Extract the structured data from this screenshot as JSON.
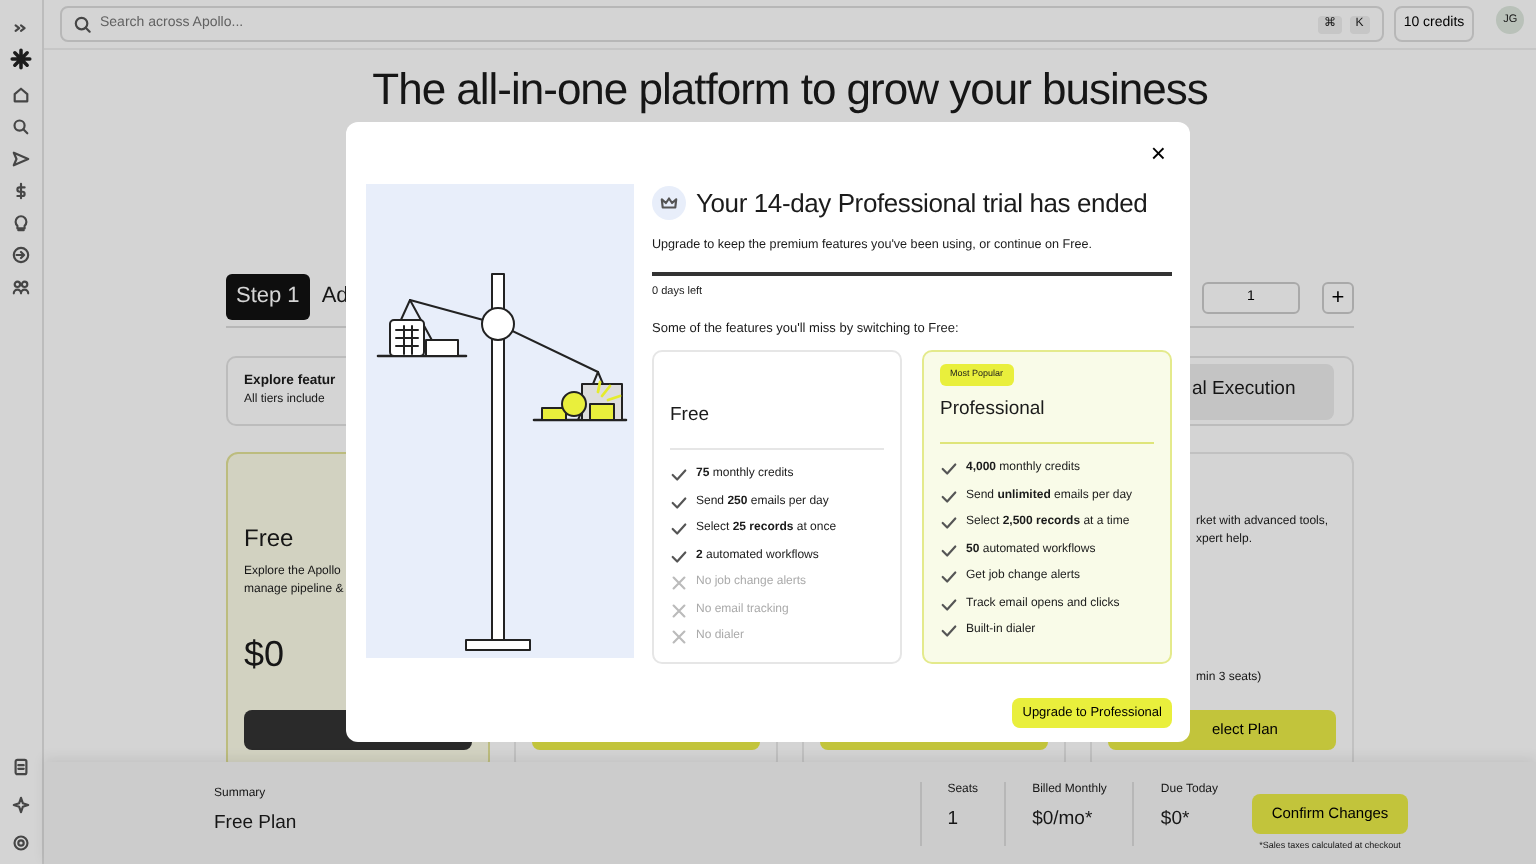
{
  "topbar": {
    "search": {
      "placeholder": "Search across Apollo..."
    },
    "shortcut": [
      "⌘",
      "K"
    ],
    "credits": "10 credits",
    "avatar": "JG"
  },
  "page": {
    "title": "The all-in-one platform to grow your business",
    "steps": [
      {
        "label": "Step 1",
        "selected": true
      },
      {
        "label": "Ad",
        "selected": false
      }
    ],
    "seats": {
      "value": "1",
      "increment": "+"
    },
    "features_box": {
      "title": "Explore featur",
      "subtitle": "All tiers include",
      "tab": "al Execution"
    },
    "plan_cards": [
      {
        "kind": "current",
        "name": "Free",
        "description": [
          "Explore the Apollo",
          "manage pipeline &"
        ],
        "price": "$0"
      },
      {
        "kind": "hidden"
      },
      {
        "kind": "hidden"
      },
      {
        "kind": "partial",
        "description": [
          "rket with advanced tools,",
          "xpert help."
        ],
        "note": "min 3 seats)",
        "button": "elect Plan"
      }
    ]
  },
  "summary": {
    "label": "Summary",
    "plan": "Free Plan",
    "stats": [
      {
        "label": "Seats",
        "value": "1"
      },
      {
        "label": "Billed Monthly",
        "value": "$0/mo*"
      },
      {
        "label": "Due Today",
        "value": "$0*"
      }
    ],
    "confirm": "Confirm Changes",
    "note": "*Sales taxes calculated at checkout"
  },
  "modal": {
    "close": "×",
    "title": "Your 14-day Professional trial has ended",
    "subtitle": "Upgrade to keep the premium features you've been using, or continue on Free.",
    "progress": {
      "level": 1
    },
    "days_left": "0 days left",
    "features_heading": "Some of the features you'll miss by switching to Free:",
    "plans": [
      {
        "name": "Free",
        "highlighted": false,
        "features": [
          {
            "text": "**75** monthly credits",
            "included": true
          },
          {
            "text": "Send **250** emails per day",
            "included": true
          },
          {
            "text": "Select **25 records** at once",
            "included": true
          },
          {
            "text": "**2** automated workflows",
            "included": true
          },
          {
            "text": "No job change alerts",
            "included": false
          },
          {
            "text": "No email tracking",
            "included": false
          },
          {
            "text": "No dialer",
            "included": false
          }
        ]
      },
      {
        "name": "Professional",
        "badge": "Most Popular",
        "highlighted": true,
        "features": [
          {
            "text": "**4,000** monthly credits",
            "included": true
          },
          {
            "text": "Send **unlimited** emails per day",
            "included": true
          },
          {
            "text": "Select **2,500 records** at a time",
            "included": true
          },
          {
            "text": "**50** automated workflows",
            "included": true
          },
          {
            "text": "Get job change alerts",
            "included": true
          },
          {
            "text": "Track email opens and clicks",
            "included": true
          },
          {
            "text": "Built-in dialer",
            "included": true
          }
        ]
      }
    ],
    "cta": "Upgrade to Professional"
  }
}
